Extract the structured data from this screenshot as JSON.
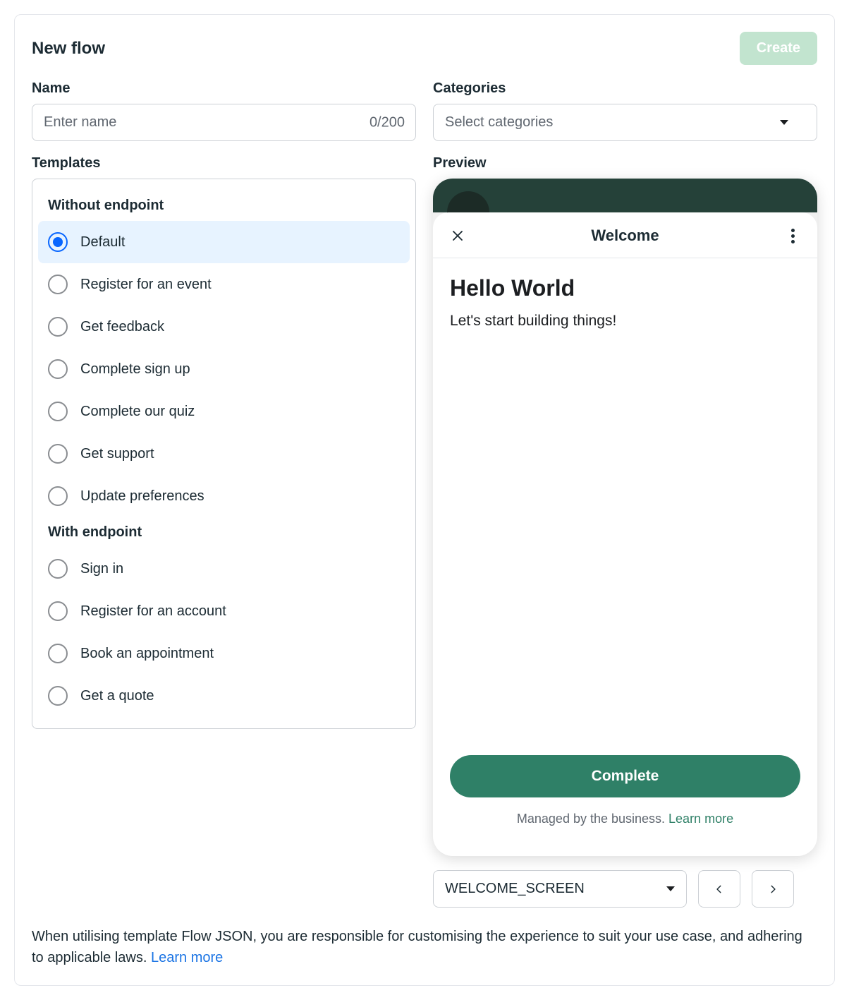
{
  "header": {
    "title": "New flow",
    "create_label": "Create"
  },
  "name": {
    "label": "Name",
    "placeholder": "Enter name",
    "value": "",
    "char_count": "0/200"
  },
  "categories": {
    "label": "Categories",
    "placeholder": "Select categories"
  },
  "templates": {
    "label": "Templates",
    "groups": [
      {
        "heading": "Without endpoint",
        "items": [
          {
            "label": "Default",
            "selected": true
          },
          {
            "label": "Register for an event",
            "selected": false
          },
          {
            "label": "Get feedback",
            "selected": false
          },
          {
            "label": "Complete sign up",
            "selected": false
          },
          {
            "label": "Complete our quiz",
            "selected": false
          },
          {
            "label": "Get support",
            "selected": false
          },
          {
            "label": "Update preferences",
            "selected": false
          }
        ]
      },
      {
        "heading": "With endpoint",
        "items": [
          {
            "label": "Sign in",
            "selected": false
          },
          {
            "label": "Register for an account",
            "selected": false
          },
          {
            "label": "Book an appointment",
            "selected": false
          },
          {
            "label": "Get a quote",
            "selected": false
          }
        ]
      }
    ]
  },
  "preview": {
    "label": "Preview",
    "sheet_title": "Welcome",
    "heading": "Hello World",
    "body": "Let's start building things!",
    "complete_label": "Complete",
    "managed_text": "Managed by the business. ",
    "managed_link": "Learn more",
    "screen_select": "WELCOME_SCREEN"
  },
  "footer": {
    "text": "When utilising template Flow JSON, you are responsible for customising the experience to suit your use case, and adhering to applicable laws. ",
    "link": "Learn more"
  }
}
